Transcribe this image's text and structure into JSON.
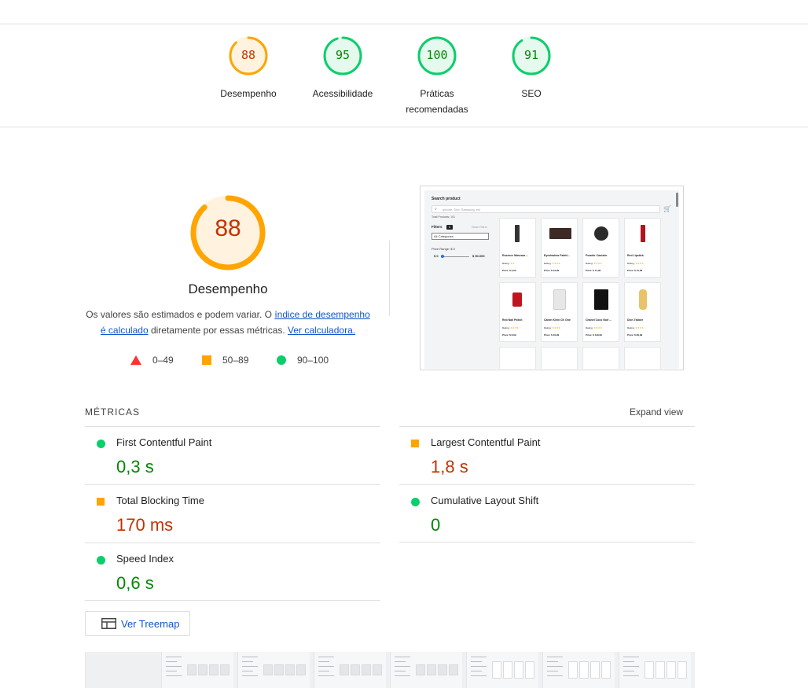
{
  "categories": [
    {
      "label": "Desempenho",
      "score": "88",
      "value": 88,
      "color": "#ffa400",
      "text_color": "#c33300",
      "bg": "#fff3e0"
    },
    {
      "label": "Acessibilidade",
      "score": "95",
      "value": 95,
      "color": "#0cce6b",
      "text_color": "#008800",
      "bg": "#e6f9ee"
    },
    {
      "label": "Práticas recomendadas",
      "score": "100",
      "value": 100,
      "color": "#0cce6b",
      "text_color": "#008800",
      "bg": "#e6f9ee"
    },
    {
      "label": "SEO",
      "score": "91",
      "value": 91,
      "color": "#0cce6b",
      "text_color": "#008800",
      "bg": "#e6f9ee"
    }
  ],
  "performance": {
    "score": "88",
    "value": 88,
    "title": "Desempenho",
    "desc_prefix": "Os valores são estimados e podem variar. O ",
    "desc_link": "índice de desempenho é calculado",
    "desc_middle": " diretamente por essas métricas. ",
    "desc_link2": "Ver calculadora."
  },
  "legend": [
    {
      "range": "0–49",
      "shape": "triangle",
      "color": "#ff3333"
    },
    {
      "range": "50–89",
      "shape": "square",
      "color": "#ffa400"
    },
    {
      "range": "90–100",
      "shape": "circle",
      "color": "#0cce6b"
    }
  ],
  "screenshot": {
    "search_title": "Search product",
    "search_placeholder": "Iphone, Dior, Samsung, etc",
    "total": "Total Products: 101",
    "filters": "Filters",
    "filters_count": "0",
    "clear": "Clean Filters",
    "category": "All Categories",
    "price_range": "Price Range: $ 0",
    "price_min": "$ 0",
    "price_max": "$ 50.000",
    "products": [
      {
        "name": "Essence Mascara ...",
        "price": "Price: $ 9,99"
      },
      {
        "name": "Eyeshadow Palett...",
        "price": "Price: $ 19,99"
      },
      {
        "name": "Powder Canister",
        "price": "Price: $ 14,99"
      },
      {
        "name": "Red Lipstick",
        "price": "Price: $ 12,99"
      },
      {
        "name": "Red Nail Polish",
        "price": "Price: $ 8,99"
      },
      {
        "name": "Calvin Klein CK One",
        "price": "Price: $ 49,99"
      },
      {
        "name": "Chanel Coco Noir ...",
        "price": "Price: $ 129,99"
      },
      {
        "name": "Dior J'adore",
        "price": "Price: $ 89,99"
      }
    ],
    "rating_label": "Rating:"
  },
  "metrics": {
    "title": "MÉTRICAS",
    "expand": "Expand view",
    "items": [
      {
        "label": "First Contentful Paint",
        "value": "0,3 s",
        "status": "pass"
      },
      {
        "label": "Largest Contentful Paint",
        "value": "1,8 s",
        "status": "average"
      },
      {
        "label": "Total Blocking Time",
        "value": "170 ms",
        "status": "average"
      },
      {
        "label": "Cumulative Layout Shift",
        "value": "0",
        "status": "pass"
      },
      {
        "label": "Speed Index",
        "value": "0,6 s",
        "status": "pass"
      }
    ]
  },
  "treemap_label": "Ver Treemap",
  "colors": {
    "pass": "#0cce6b",
    "pass_text": "#008800",
    "average": "#ffa400",
    "average_text": "#c33300",
    "link": "#1155cc"
  }
}
